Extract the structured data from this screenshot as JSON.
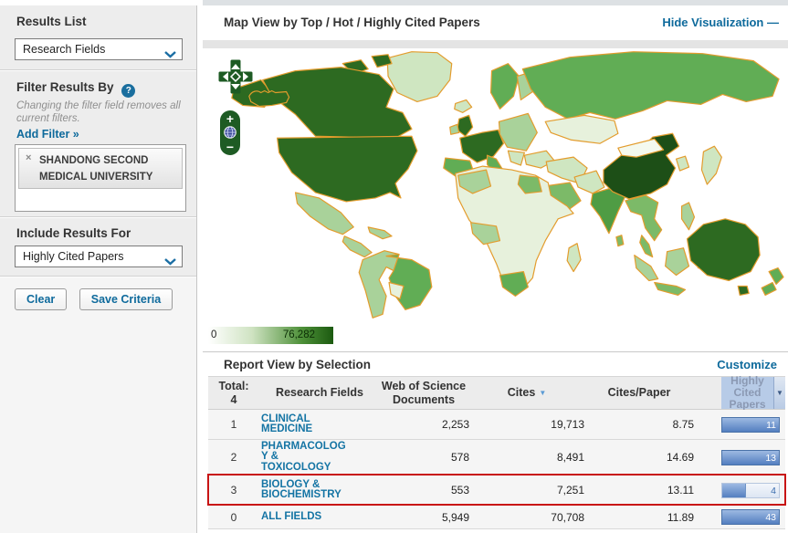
{
  "sidebar": {
    "results_list_label": "Results List",
    "results_list_value": "Research Fields",
    "filter_by_label": "Filter Results By",
    "filter_note": "Changing the filter field removes all current filters.",
    "add_filter_label": "Add Filter »",
    "filter_tag": {
      "remove_icon": "×",
      "label": "SHANDONG SECOND MEDICAL UNIVERSITY"
    },
    "include_results_label": "Include Results For",
    "include_results_value": "Highly Cited Papers",
    "clear_button": "Clear",
    "save_button": "Save Criteria"
  },
  "map_panel": {
    "title": "Map View by Top / Hot / Highly Cited Papers",
    "hide_link": "Hide Visualization",
    "hide_icon": "—",
    "zoom_in": "+",
    "zoom_out": "−",
    "legend": {
      "min": "0",
      "max": "76,282"
    },
    "shading_note": "choropleth: darkest=China; dark=USA, Canada, W Europe, UK, Australia; medium=Russia, Brazil, India, Spain, Egypt, Saudi Arabia, South Africa, New Zealand; light/pale=Mexico, E Europe, Japan, SE Asia, most of Africa, Kazakhstan, Greenland"
  },
  "report": {
    "title": "Report View by Selection",
    "customize_link": "Customize",
    "columns": {
      "total_label": "Total:",
      "total_value": "4",
      "field": "Research Fields",
      "wos": "Web of Science Documents",
      "cites": "Cites",
      "cites_per_paper": "Cites/Paper",
      "highly_cited": "Highly Cited Papers"
    },
    "rows": [
      {
        "rank": "1",
        "field": "CLINICAL MEDICINE",
        "wos": "2,253",
        "cites": "19,713",
        "cpp": "8.75",
        "hcp": "11",
        "bar_pct": 100,
        "highlighted": false
      },
      {
        "rank": "2",
        "field": "PHARMACOLOGY & TOXICOLOGY",
        "wos": "578",
        "cites": "8,491",
        "cpp": "14.69",
        "hcp": "13",
        "bar_pct": 100,
        "highlighted": false
      },
      {
        "rank": "3",
        "field": "BIOLOGY & BIOCHEMISTRY",
        "wos": "553",
        "cites": "7,251",
        "cpp": "13.11",
        "hcp": "4",
        "bar_pct": 42,
        "highlighted": true
      },
      {
        "rank": "0",
        "field": "ALL FIELDS",
        "wos": "5,949",
        "cites": "70,708",
        "cpp": "11.89",
        "hcp": "43",
        "bar_pct": 100,
        "highlighted": false
      }
    ]
  },
  "icons": {
    "sort_desc": "▼",
    "column_menu": "▼",
    "question": "?"
  },
  "colors": {
    "accent_blue": "#0e6a9c",
    "sorted_blue": "#5b9bd5",
    "highlight_red": "#c81414",
    "hcp_header_bg": "#b7cbe7",
    "map_border": "#e39c2d",
    "map_dark": "#2d6a21",
    "map_darkest": "#1d4f17",
    "map_medium": "#61ad55",
    "map_medium2": "#7cba68",
    "map_india": "#4f9c44",
    "map_light": "#a9d29a",
    "map_pale": "#cfe6c1",
    "map_paler": "#e7f1dc",
    "legend_dark": "#1c5a10",
    "bar_blue": "#547fc0"
  }
}
